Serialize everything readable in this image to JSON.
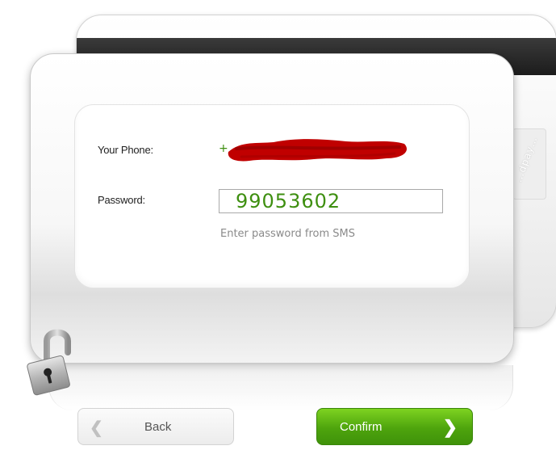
{
  "form": {
    "phone_label": "Your Phone:",
    "phone_value_prefix": "+",
    "phone_value_redacted": true,
    "password_label": "Password:",
    "password_value": "99053602",
    "password_hint": "Enter password from SMS"
  },
  "back_card": {
    "signature_text": "…dpay…"
  },
  "buttons": {
    "back_label": "Back",
    "back_icon": "chevron-left-icon",
    "confirm_label": "Confirm",
    "confirm_icon": "chevron-right-icon"
  },
  "icons": {
    "lock": "open-padlock-icon"
  },
  "colors": {
    "accent_green": "#4ea40d",
    "value_green": "#3e8f10",
    "redaction_red": "#c00000"
  }
}
